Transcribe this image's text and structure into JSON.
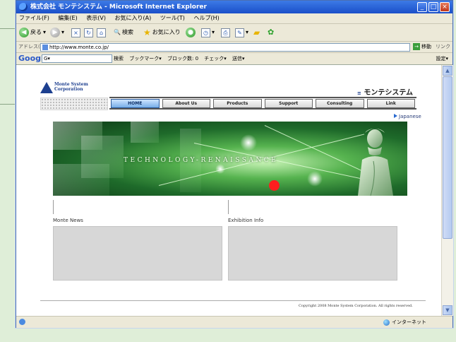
{
  "window": {
    "title": "株式会社 モンテシステム - Microsoft Internet Explorer",
    "controls": [
      "_",
      "□",
      "×"
    ]
  },
  "menubar": [
    "ファイル(F)",
    "編集(E)",
    "表示(V)",
    "お気に入り(A)",
    "ツール(T)",
    "ヘルプ(H)"
  ],
  "toolbar": {
    "back": "戻る",
    "search": "検索",
    "favorites": "お気に入り"
  },
  "address": {
    "label": "アドレス(D)",
    "url": "http://www.monte.co.jp/",
    "go": "移動",
    "links": "リンク"
  },
  "googlebar": {
    "logo": "Google",
    "field": "G▾",
    "items": [
      "検索",
      "ブックマーク▾",
      "ブロック数: 0",
      "チェック▾",
      "送信▾"
    ],
    "settings": "設定▾"
  },
  "site": {
    "logo_line1": "Monte System",
    "logo_line2": "Corporation",
    "brand_jp": "モンテシステム",
    "nav": [
      "HOME",
      "About Us",
      "Products",
      "Support",
      "Consulting",
      "Link"
    ],
    "lang": "Japanese",
    "banner_text": "TECHNOLOGY-RENAISSANCE",
    "news_title": "Monte News",
    "exhibition_title": "Exhibition Info",
    "copyright": "Copyright 2008 Monte System Corporation. All rights reserved."
  },
  "status": {
    "zone": "インターネット"
  },
  "colors": {
    "active_nav": "#76aee8",
    "banner_green": "#1e6a2a",
    "marker": "#ff1e1e"
  }
}
